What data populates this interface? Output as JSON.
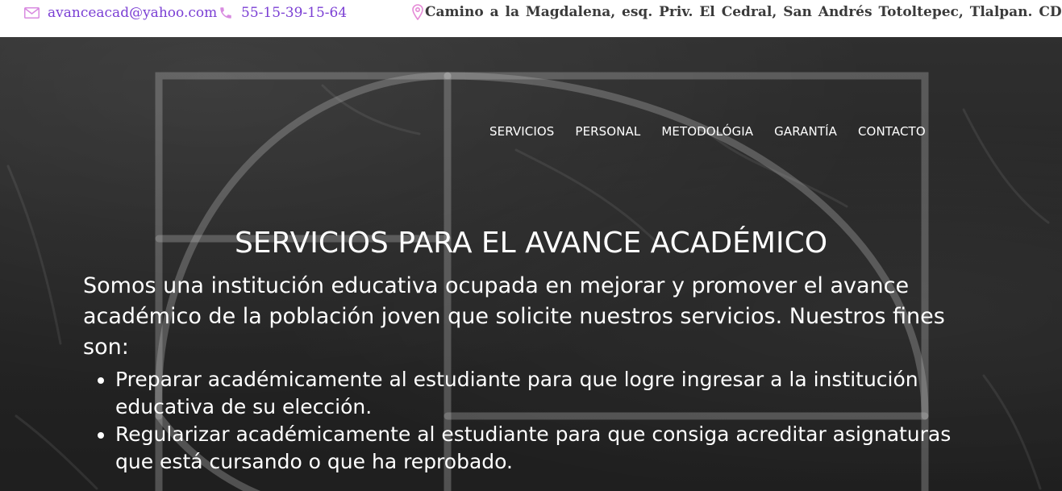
{
  "contact": {
    "email": "avanceacad@yahoo.com",
    "phone": "55-15-39-15-64",
    "address": "Camino a la Magdalena, esq. Priv. El Cedral, San Andrés Totoltepec, Tlalpan. CDMX.",
    "accent_color": "#7b3fd4",
    "address_icon_color": "#e58ad6",
    "email_icon": "envelope-icon",
    "phone_icon": "phone-icon",
    "address_icon": "map-pin-icon"
  },
  "nav": {
    "items": [
      "SERVICIOS",
      "PERSONAL",
      "METODOLÓGIA",
      "GARANTÍA",
      "CONTACTO"
    ]
  },
  "hero": {
    "title": "SERVICIOS PARA EL AVANCE ACADÉMICO",
    "intro": "Somos una institución educativa ocupada en mejorar y promover el avance académico de la población joven que solicite nuestros servicios. Nuestros fines son:",
    "goals": [
      "Preparar académicamente al estudiante para que logre ingresar a la institución educativa de su elección.",
      "Regularizar académicamente al estudiante para que consiga acreditar asignaturas que está cursando o que ha reprobado."
    ]
  }
}
